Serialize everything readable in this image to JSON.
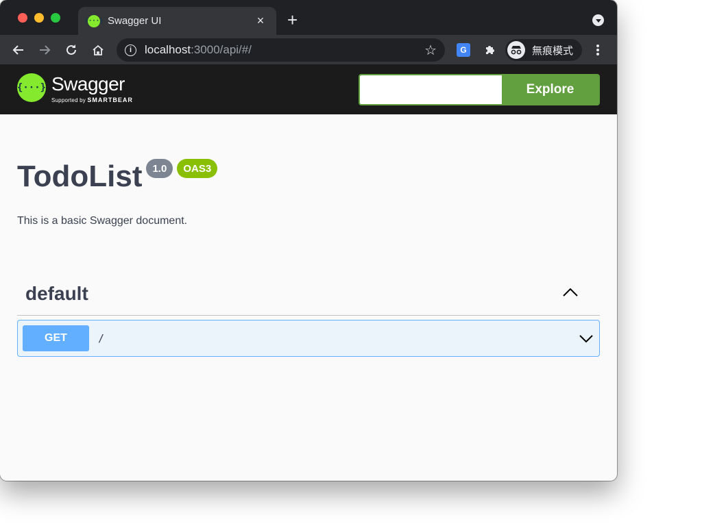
{
  "browser": {
    "tab_title": "Swagger UI",
    "tab_favicon": "{···}",
    "tab_close": "×",
    "new_tab": "+",
    "url_host": "localhost",
    "url_rest": ":3000/api/#/",
    "incognito_label": "無痕模式",
    "icons": [
      "back-icon",
      "forward-icon",
      "reload-icon",
      "home-icon",
      "info-icon",
      "star-icon",
      "translate-icon",
      "puzzle-icon",
      "incognito-icon",
      "more-icon"
    ]
  },
  "topbar": {
    "logo_mark": "{···}",
    "logo_name": "Swagger",
    "logo_sub_prefix": "Supported by ",
    "logo_sub_brand": "SMARTBEAR",
    "explore_value": "",
    "explore_label": "Explore",
    "brand_color": "#85ea2d",
    "button_color": "#62a03f"
  },
  "info": {
    "title": "TodoList",
    "version": "1.0",
    "oas_badge": "OAS3",
    "description": "This is a basic Swagger document."
  },
  "tags": [
    {
      "name": "default",
      "expanded": true,
      "operations": [
        {
          "method": "GET",
          "path": "/",
          "color": "#61affe"
        }
      ]
    }
  ]
}
